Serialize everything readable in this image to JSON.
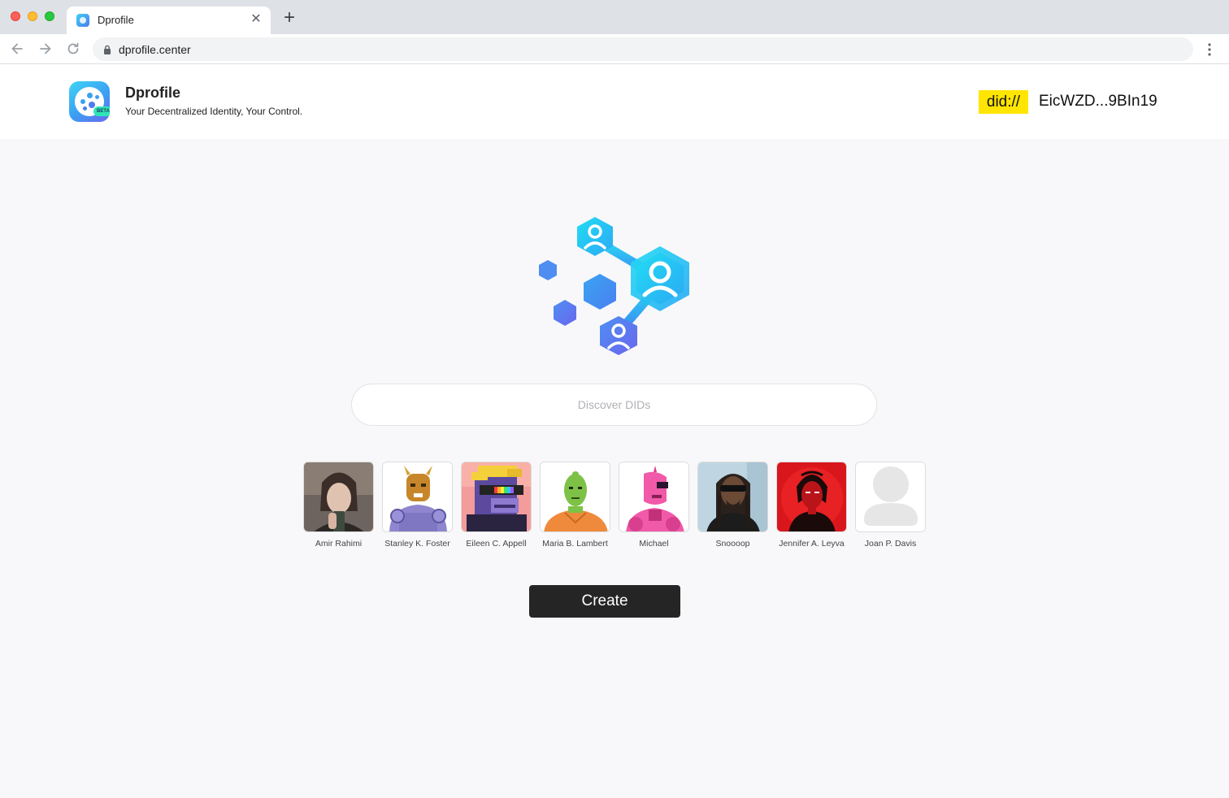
{
  "browser": {
    "tab_title": "Dprofile",
    "url": "dprofile.center",
    "icons": {
      "back": "arrow-left-icon",
      "forward": "arrow-right-icon",
      "reload": "reload-icon",
      "lock": "lock-icon",
      "menu": "kebab-menu-icon",
      "new_tab": "plus-icon",
      "close_tab": "close-icon"
    }
  },
  "header": {
    "brand_name": "Dprofile",
    "tagline": "Your Decentralized Identity, Your Control.",
    "logo_badge": "BETA",
    "did_prefix": "did://",
    "did_value": "EicWZD...9BIn19"
  },
  "search": {
    "placeholder": "Discover DIDs"
  },
  "avatars": [
    {
      "name": "Amir Rahimi"
    },
    {
      "name": "Stanley K. Foster"
    },
    {
      "name": "Eileen C. Appell"
    },
    {
      "name": "Maria B. Lambert"
    },
    {
      "name": "Michael"
    },
    {
      "name": "Snoooop"
    },
    {
      "name": "Jennifer A. Leyva"
    },
    {
      "name": "Joan P. Davis"
    }
  ],
  "actions": {
    "create_label": "Create"
  },
  "colors": {
    "did_badge": "#ffe500",
    "button_bg": "#252525",
    "hero_gradient_start": "#2fd6f4",
    "hero_gradient_end": "#5c6cf0"
  }
}
